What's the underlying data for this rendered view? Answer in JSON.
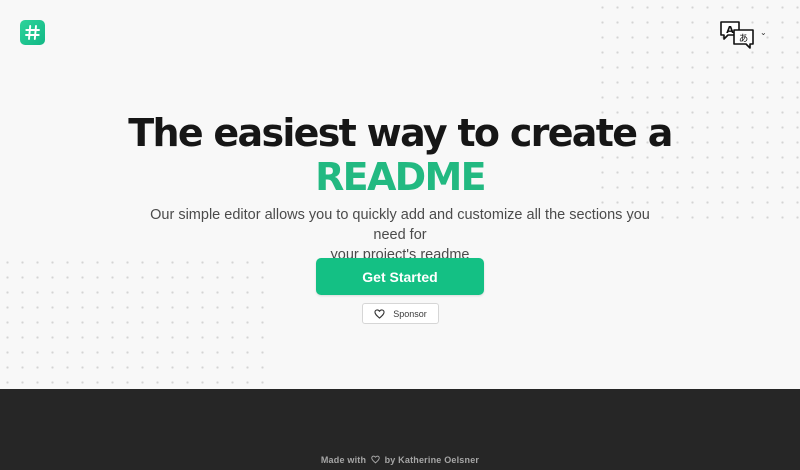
{
  "header": {
    "logo_icon": "hash-icon",
    "language_icon": "translate-icon",
    "language_dropdown_icon": "chevron-down-icon"
  },
  "hero": {
    "title_line1": "The easiest way to create a",
    "title_line2": "README",
    "subtitle_line1": "Our simple editor allows you to quickly add and customize all the sections you need for",
    "subtitle_line2": "your project's readme",
    "cta_label": "Get Started",
    "sponsor_label": "Sponsor",
    "sponsor_icon": "heart-icon"
  },
  "footer": {
    "credit_prefix": "Made with",
    "credit_suffix": "by Katherine Oelsner"
  },
  "colors": {
    "accent": "#22b981",
    "button": "#14c084",
    "footer_bg": "#262626",
    "page_bg": "#f8f8f8"
  }
}
